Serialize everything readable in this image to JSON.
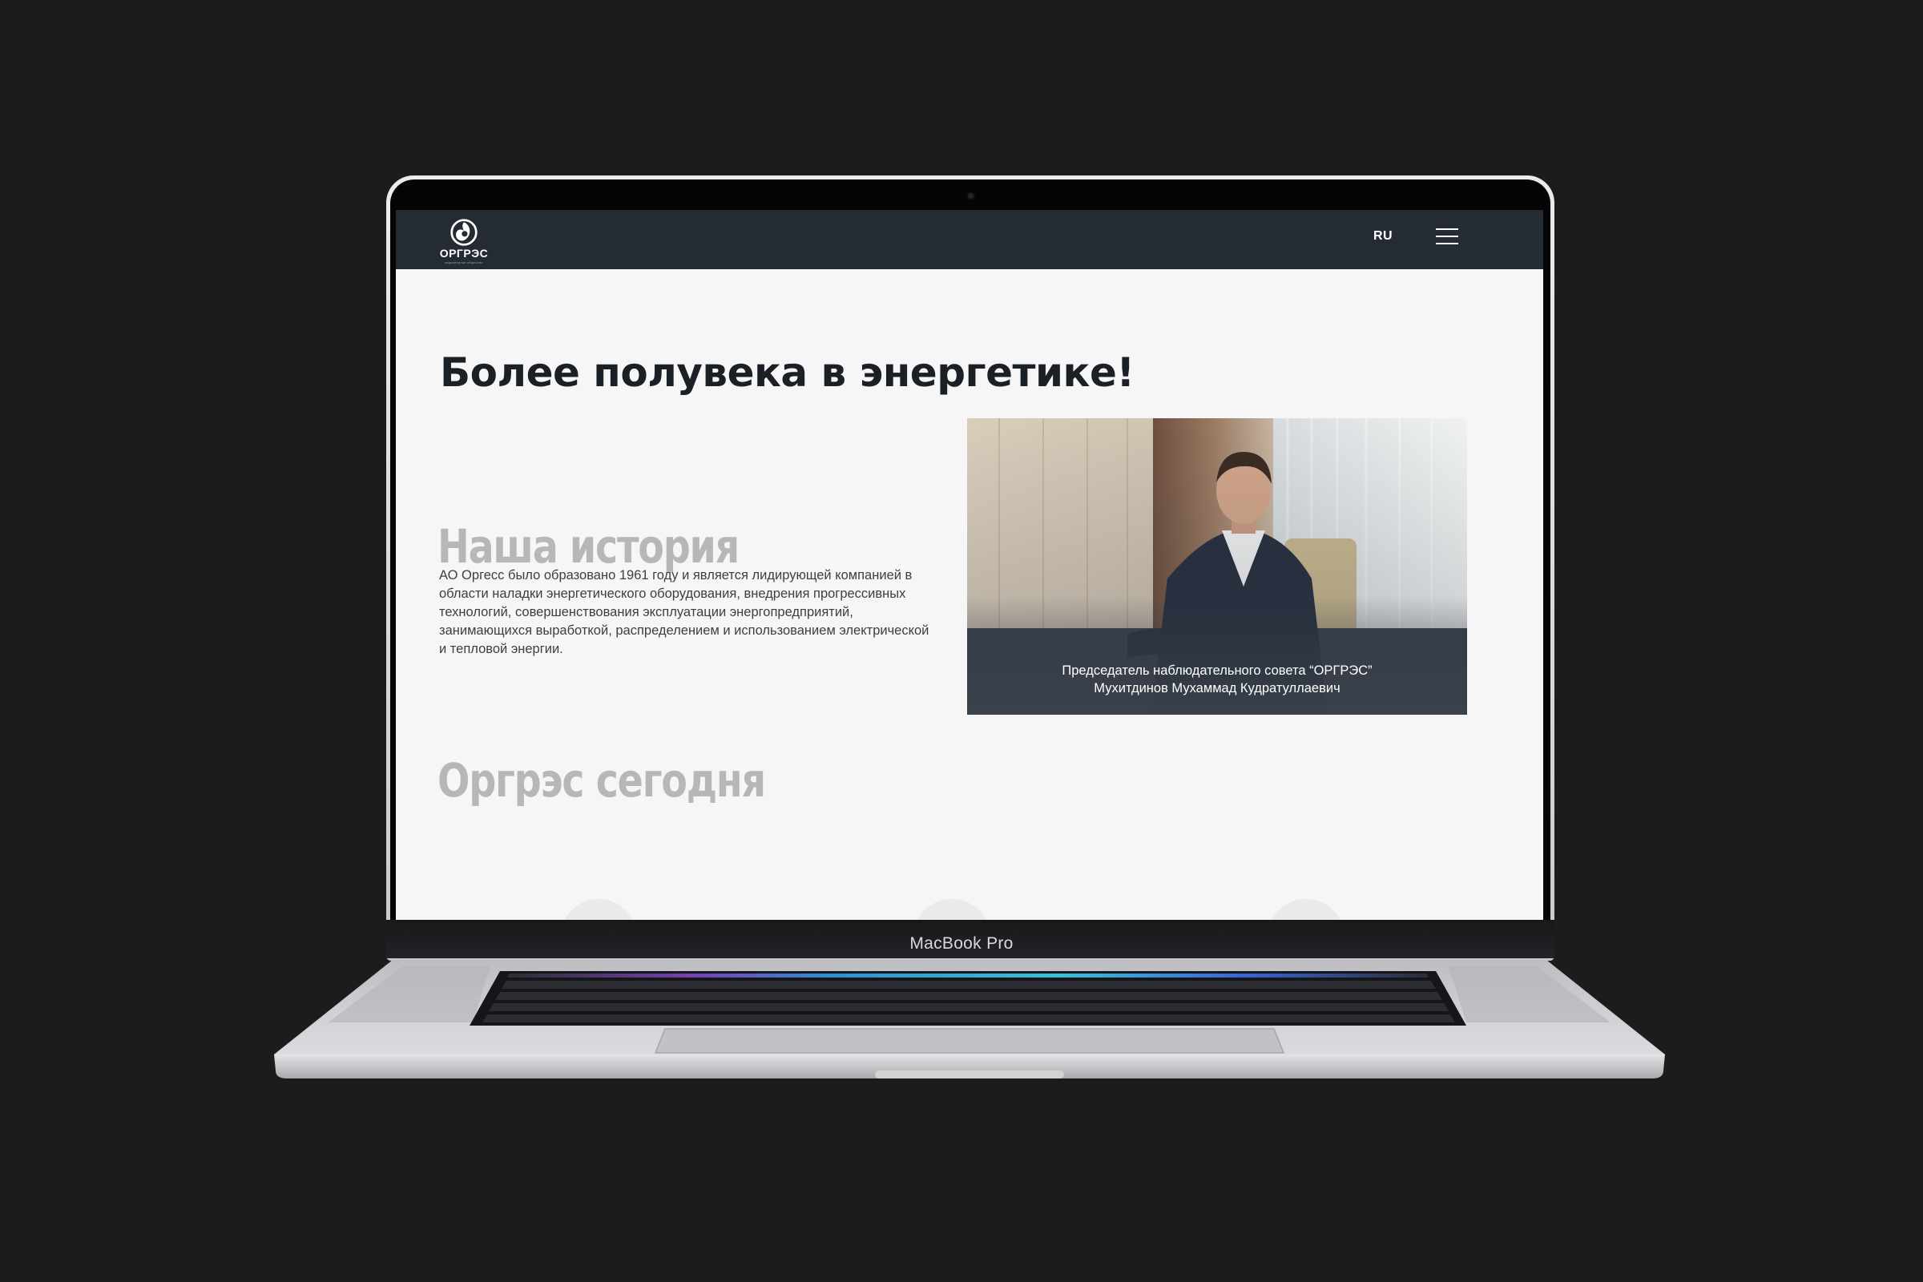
{
  "site": {
    "logo_name": "ОРГРЭС",
    "logo_sub": "акционерное общество",
    "lang": "RU",
    "colors": {
      "header_bg": "#252b33",
      "page_bg": "#f6f6f6",
      "title": "#1b1f26",
      "section_title": "#b7b7b7"
    }
  },
  "hero": {
    "title": "Более полувека в энергетике!"
  },
  "history": {
    "title": "Наша история",
    "text": "АО Оргесс было образовано 1961 году и является лидирующей компанией в области наладки энергетического оборудования, внедрения прогрессивных технологий, совершенствования эксплуатации энергопредприятий, занимающихся выработкой, распределением и использованием электрической и тепловой энергии."
  },
  "video": {
    "caption_line1": "Председатель наблюдательного совета “ОРГРЭС”",
    "caption_line2": "Мухитдинов Мухаммад Кудратуллаевич"
  },
  "today": {
    "title": "Оргрэс сегодня"
  },
  "device": {
    "label": "MacBook Pro"
  },
  "icons": [
    "logo-mark-icon",
    "hamburger-menu-icon"
  ]
}
